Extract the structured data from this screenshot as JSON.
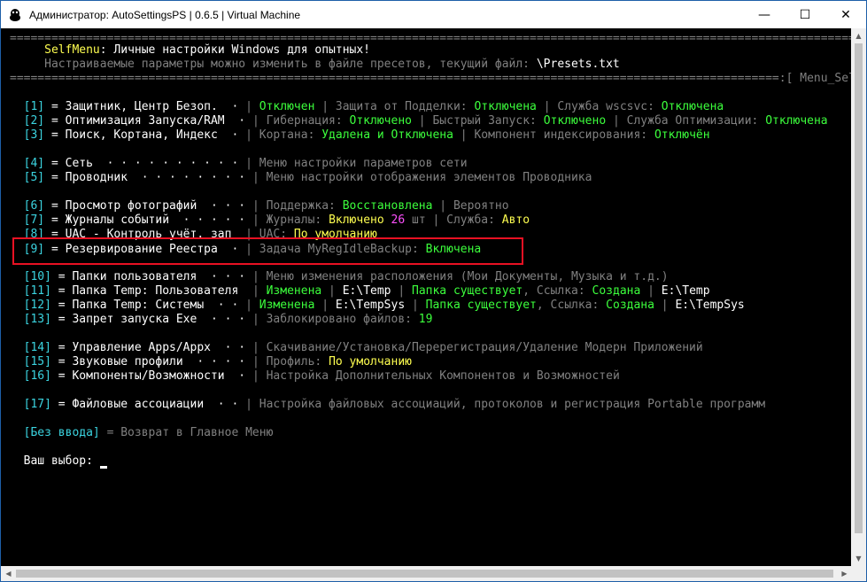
{
  "window": {
    "title": "Администратор: AutoSettingsPS | 0.6.5 | Virtual Machine",
    "minimize": "—",
    "maximize": "☐",
    "close": "✕"
  },
  "header": {
    "sep_line": "=============================================================================================================================================================",
    "title_label": "SelfMenu",
    "title_rest": ": Личные настройки Windows для опытных!",
    "subtitle": "Настраиваемые параметры можно изменить в файле пресетов, текущий файл: ",
    "preset_file": "\\Presets.txt",
    "sep_line2_a": "===============================================================================================================",
    "menu_name": ":[ Menu_SelfMenu ]:===",
    "menu_name_pre": "=="
  },
  "items": {
    "i1": {
      "num": "[1]",
      "label": " = Защитник, Центр Безоп.  · ",
      "sep": "|",
      "t1": " Отключен ",
      "s1": "|",
      "t2": " Защита от Подделки: ",
      "t3": "Отключена",
      "s2": " | ",
      "t4": "Служба wscsvc: ",
      "t5": "Отключена"
    },
    "i2": {
      "num": "[2]",
      "label": " = Оптимизация Запуска/RAM  · ",
      "sep": "|",
      "t1": " Гибернация: ",
      "t2": "Отключено",
      "s1": " | ",
      "t3": "Быстрый Запуск: ",
      "t4": "Отключено",
      "s2": " | ",
      "t5": "Служба Оптимизации: ",
      "t6": "Отключена"
    },
    "i3": {
      "num": "[3]",
      "label": " = Поиск, Кортана, Индекс  · ",
      "sep": "|",
      "t1": " Кортана: ",
      "t2": "Удалена и Отключена",
      "s1": " | ",
      "t3": "Компонент индексирования: ",
      "t4": "Отключён"
    },
    "i4": {
      "num": "[4]",
      "label": " = Сеть  · · · · · · · · · · ",
      "sep": "|",
      "t1": " Меню настройки параметров сети"
    },
    "i5": {
      "num": "[5]",
      "label": " = Проводник  · · · · · · · · ",
      "sep": "|",
      "t1": " Меню настройки отображения элементов Проводника"
    },
    "i6": {
      "num": "[6]",
      "label": " = Просмотр фотографий  · · · ",
      "sep": "|",
      "t1": " Поддержка: ",
      "t2": "Восстановлена",
      "s1": " | ",
      "t3": "Вероятно"
    },
    "i7": {
      "num": "[7]",
      "label": " = Журналы событий  · · · · · ",
      "sep": "|",
      "t1": " Журналы: ",
      "t2": "Включено",
      "t3": " 26",
      "t4": " шт",
      "s1": " | ",
      "t5": "Служба: ",
      "t6": "Авто"
    },
    "i8": {
      "num": "[8]",
      "label": " = UAC - Контроль учёт. зап  ",
      "sep": "|",
      "t1": " UAC: ",
      "t2": "По умолчанию"
    },
    "i9": {
      "num": "[9]",
      "label": " = Резервирование Реестра  · ",
      "sep": "|",
      "t1": " Задача MyRegIdleBackup: ",
      "t2": "Включена"
    },
    "i10": {
      "num": "[10]",
      "label": " = Папки пользователя  · · · ",
      "sep": "|",
      "t1": " Меню изменения расположения (Мои Документы, Музыка и т.д.)"
    },
    "i11": {
      "num": "[11]",
      "label": " = Папка Temp: Пользователя  ",
      "sep": "|",
      "t1": " Изменена",
      "s1": " | ",
      "t2": "E:\\Temp",
      "s2": " | ",
      "t3": "Папка существует",
      "t4": ", Ссылка: ",
      "t5": "Создана",
      "s3": " | ",
      "t6": "E:\\Temp"
    },
    "i12": {
      "num": "[12]",
      "label": " = Папка Temp: Системы  · · ",
      "sep": "|",
      "t1": " Изменена",
      "s1": " | ",
      "t2": "E:\\TempSys",
      "s2": " | ",
      "t3": "Папка существует",
      "t4": ", Ссылка: ",
      "t5": "Создана",
      "s3": " | ",
      "t6": "E:\\TempSys"
    },
    "i13": {
      "num": "[13]",
      "label": " = Запрет запуска Exe  · · · ",
      "sep": "|",
      "t1": " Заблокировано файлов: ",
      "t2": "19"
    },
    "i14": {
      "num": "[14]",
      "label": " = Управление Apps/Appx  · · ",
      "sep": "|",
      "t1": " Скачивание/Установка/Перерегистрация/Удаление Модерн Приложений"
    },
    "i15": {
      "num": "[15]",
      "label": " = Звуковые профили  · · · · ",
      "sep": "|",
      "t1": " Профиль: ",
      "t2": "По умолчанию"
    },
    "i16": {
      "num": "[16]",
      "label": " = Компоненты/Возможности  · ",
      "sep": "|",
      "t1": " Настройка Дополнительных Компонентов и Возможностей"
    },
    "i17": {
      "num": "[17]",
      "label": " = Файловые ассоциации  · · ",
      "sep": "|",
      "t1": " Настройка файловых ассоциаций, протоколов и регистрация Portable программ"
    }
  },
  "footer": {
    "no_input": "[Без ввода]",
    "no_input_rest": " = Возврат в Главное Меню",
    "prompt": "Ваш выбор: "
  }
}
